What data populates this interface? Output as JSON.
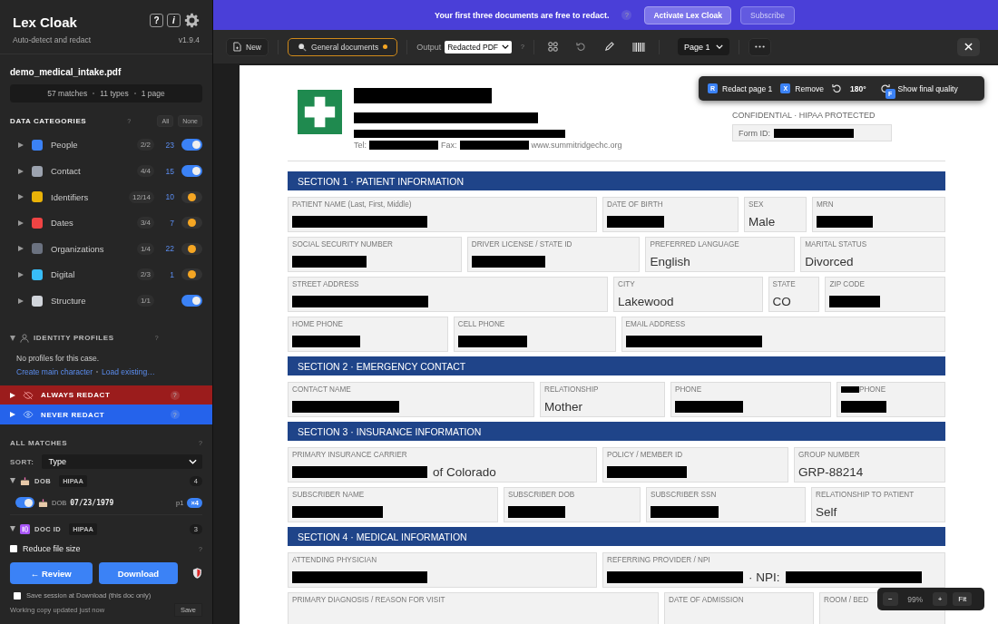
{
  "app": {
    "title": "Lex Cloak",
    "subtitle": "Auto-detect and redact",
    "version": "v1.9.4",
    "help": "?",
    "info": "i"
  },
  "file": {
    "name": "demo_medical_intake.pdf",
    "stats": [
      "57 matches",
      "11 types",
      "1 page"
    ]
  },
  "categories": {
    "title": "DATA CATEGORIES",
    "help": "?",
    "all": "All",
    "none": "None",
    "items": [
      {
        "name": "People",
        "ratio": "2/2",
        "count": "23",
        "on": true
      },
      {
        "name": "Contact",
        "ratio": "4/4",
        "count": "15",
        "on": true
      },
      {
        "name": "Identifiers",
        "ratio": "12/14",
        "count": "10",
        "on": false
      },
      {
        "name": "Dates",
        "ratio": "3/4",
        "count": "7",
        "on": false
      },
      {
        "name": "Organizations",
        "ratio": "1/4",
        "count": "22",
        "on": false
      },
      {
        "name": "Digital",
        "ratio": "2/3",
        "count": "1",
        "on": false
      },
      {
        "name": "Structure",
        "ratio": "1/1",
        "on": true
      }
    ]
  },
  "identity_profiles": {
    "title": "IDENTITY PROFILES",
    "help": "?",
    "expanded": true,
    "empty_text": "No profiles for this case.",
    "links": [
      "Create main character",
      "Load existing…"
    ]
  },
  "rule_bars": [
    {
      "kind": "always",
      "label": "ALWAYS REDACT",
      "help": "?",
      "expanded": false
    },
    {
      "kind": "never",
      "label": "NEVER REDACT",
      "help": "?",
      "expanded": false
    }
  ],
  "matches": {
    "title": "ALL MATCHES",
    "help": "?",
    "sort_label": "SORT:",
    "sort": "Type",
    "groups": [
      {
        "kind": "dob",
        "name": "DOB",
        "tag": "HIPAA",
        "count": "4",
        "expanded": true,
        "items": [
          {
            "on": true,
            "type": "DOB",
            "value": "07/23/1979",
            "page": "p1",
            "occurrences": "×4"
          }
        ]
      },
      {
        "kind": "docid",
        "name": "DOC ID",
        "tag": "HIPAA",
        "count": "3",
        "expanded": true
      }
    ]
  },
  "reduce_size": {
    "label": "Reduce file size",
    "checked": false,
    "help": "?"
  },
  "actions": {
    "review": "← Review",
    "download": "Download"
  },
  "save_session": {
    "label": "Save session at Download (this doc only)",
    "checked": false
  },
  "status": {
    "text": "Working copy updated just now",
    "save": "Save"
  },
  "banner": {
    "text": "Your first three documents are free to redact.",
    "help": "?",
    "activate": "Activate Lex Cloak",
    "subscribe": "Subscribe"
  },
  "toolbar": {
    "new": "New",
    "profile": "General documents",
    "profile_modified": true,
    "output_label": "Output",
    "output": "Redacted PDF",
    "help": "?",
    "page": "Page 1"
  },
  "overlay": {
    "redact_key": "R",
    "redact": "Redact page 1",
    "remove_key": "X",
    "remove": "Remove",
    "angle": "180°",
    "quality_key": "F",
    "quality": "Show final quality"
  },
  "zoom": {
    "out": "−",
    "value": "99%",
    "in": "+",
    "fit": "Fit"
  },
  "document": {
    "header": {
      "tel_label": "Tel:",
      "fax_label": "Fax:",
      "website": "www.summitridgechc.org",
      "notice": "CONFIDENTIAL · HIPAA PROTECTED",
      "form_id_label": "Form ID:"
    },
    "sections": [
      {
        "title": "SECTION 1 · PATIENT INFORMATION",
        "rows": [
          {
            "fields": [
              {
                "label": "PATIENT NAME (Last, First, Middle)",
                "value": [
                  {
                    "kind": "redacted"
                  }
                ]
              },
              {
                "label": "DATE OF BIRTH",
                "value": [
                  {
                    "kind": "redacted"
                  }
                ]
              },
              {
                "label": "SEX",
                "value": [
                  {
                    "kind": "text",
                    "text": "Male"
                  }
                ]
              },
              {
                "label": "MRN",
                "value": [
                  {
                    "kind": "redacted"
                  }
                ]
              }
            ]
          },
          {
            "fields": [
              {
                "label": "SOCIAL SECURITY NUMBER",
                "value": [
                  {
                    "kind": "redacted"
                  }
                ]
              },
              {
                "label": "DRIVER LICENSE / STATE ID",
                "value": [
                  {
                    "kind": "redacted"
                  }
                ]
              },
              {
                "label": "PREFERRED LANGUAGE",
                "value": [
                  {
                    "kind": "text",
                    "text": "English"
                  }
                ]
              },
              {
                "label": "MARITAL STATUS",
                "value": [
                  {
                    "kind": "text",
                    "text": "Divorced"
                  }
                ]
              }
            ]
          },
          {
            "fields": [
              {
                "label": "STREET ADDRESS",
                "value": [
                  {
                    "kind": "redacted"
                  }
                ]
              },
              {
                "label": "CITY",
                "value": [
                  {
                    "kind": "text",
                    "text": "Lakewood"
                  }
                ]
              },
              {
                "label": "STATE",
                "value": [
                  {
                    "kind": "text",
                    "text": "CO"
                  }
                ]
              },
              {
                "label": "ZIP CODE",
                "value": [
                  {
                    "kind": "redacted"
                  }
                ]
              }
            ]
          },
          {
            "fields": [
              {
                "label": "HOME PHONE",
                "value": [
                  {
                    "kind": "redacted"
                  }
                ]
              },
              {
                "label": "CELL PHONE",
                "value": [
                  {
                    "kind": "redacted"
                  }
                ]
              },
              {
                "label": "EMAIL ADDRESS",
                "value": [
                  {
                    "kind": "redacted"
                  }
                ]
              }
            ]
          }
        ]
      },
      {
        "title": "SECTION 2 · EMERGENCY CONTACT",
        "rows": [
          {
            "fields": [
              {
                "label": "CONTACT NAME",
                "value": [
                  {
                    "kind": "redacted"
                  }
                ]
              },
              {
                "label": "RELATIONSHIP",
                "value": [
                  {
                    "kind": "text",
                    "text": "Mother"
                  }
                ]
              },
              {
                "label": "PHONE",
                "value": [
                  {
                    "kind": "redacted"
                  }
                ]
              },
              {
                "label": "PHONE",
                "masked_label": true,
                "value": [
                  {
                    "kind": "redacted"
                  }
                ]
              }
            ]
          }
        ]
      },
      {
        "title": "SECTION 3 · INSURANCE INFORMATION",
        "rows": [
          {
            "fields": [
              {
                "label": "PRIMARY INSURANCE CARRIER",
                "value": [
                  {
                    "kind": "redacted"
                  },
                  {
                    "kind": "text",
                    "text": "of Colorado"
                  }
                ]
              },
              {
                "label": "POLICY / MEMBER ID",
                "value": [
                  {
                    "kind": "redacted"
                  }
                ]
              },
              {
                "label": "GROUP NUMBER",
                "value": [
                  {
                    "kind": "text",
                    "text": "GRP-88214"
                  }
                ]
              }
            ]
          },
          {
            "fields": [
              {
                "label": "SUBSCRIBER NAME",
                "value": [
                  {
                    "kind": "redacted"
                  }
                ]
              },
              {
                "label": "SUBSCRIBER DOB",
                "value": [
                  {
                    "kind": "redacted"
                  }
                ]
              },
              {
                "label": "SUBSCRIBER SSN",
                "value": [
                  {
                    "kind": "redacted"
                  }
                ]
              },
              {
                "label": "RELATIONSHIP TO PATIENT",
                "value": [
                  {
                    "kind": "text",
                    "text": "Self"
                  }
                ]
              }
            ]
          }
        ]
      },
      {
        "title": "SECTION 4 · MEDICAL INFORMATION",
        "rows": [
          {
            "fields": [
              {
                "label": "ATTENDING PHYSICIAN",
                "value": [
                  {
                    "kind": "redacted"
                  }
                ]
              },
              {
                "label": "REFERRING PROVIDER / NPI",
                "value": [
                  {
                    "kind": "redacted"
                  },
                  {
                    "kind": "text",
                    "text": "·  NPI:"
                  },
                  {
                    "kind": "redacted"
                  }
                ]
              }
            ]
          },
          {
            "fields": [
              {
                "label": "PRIMARY DIAGNOSIS / REASON FOR VISIT"
              },
              {
                "label": "DATE OF ADMISSION"
              },
              {
                "label": "ROOM / BED"
              }
            ]
          }
        ]
      }
    ]
  }
}
